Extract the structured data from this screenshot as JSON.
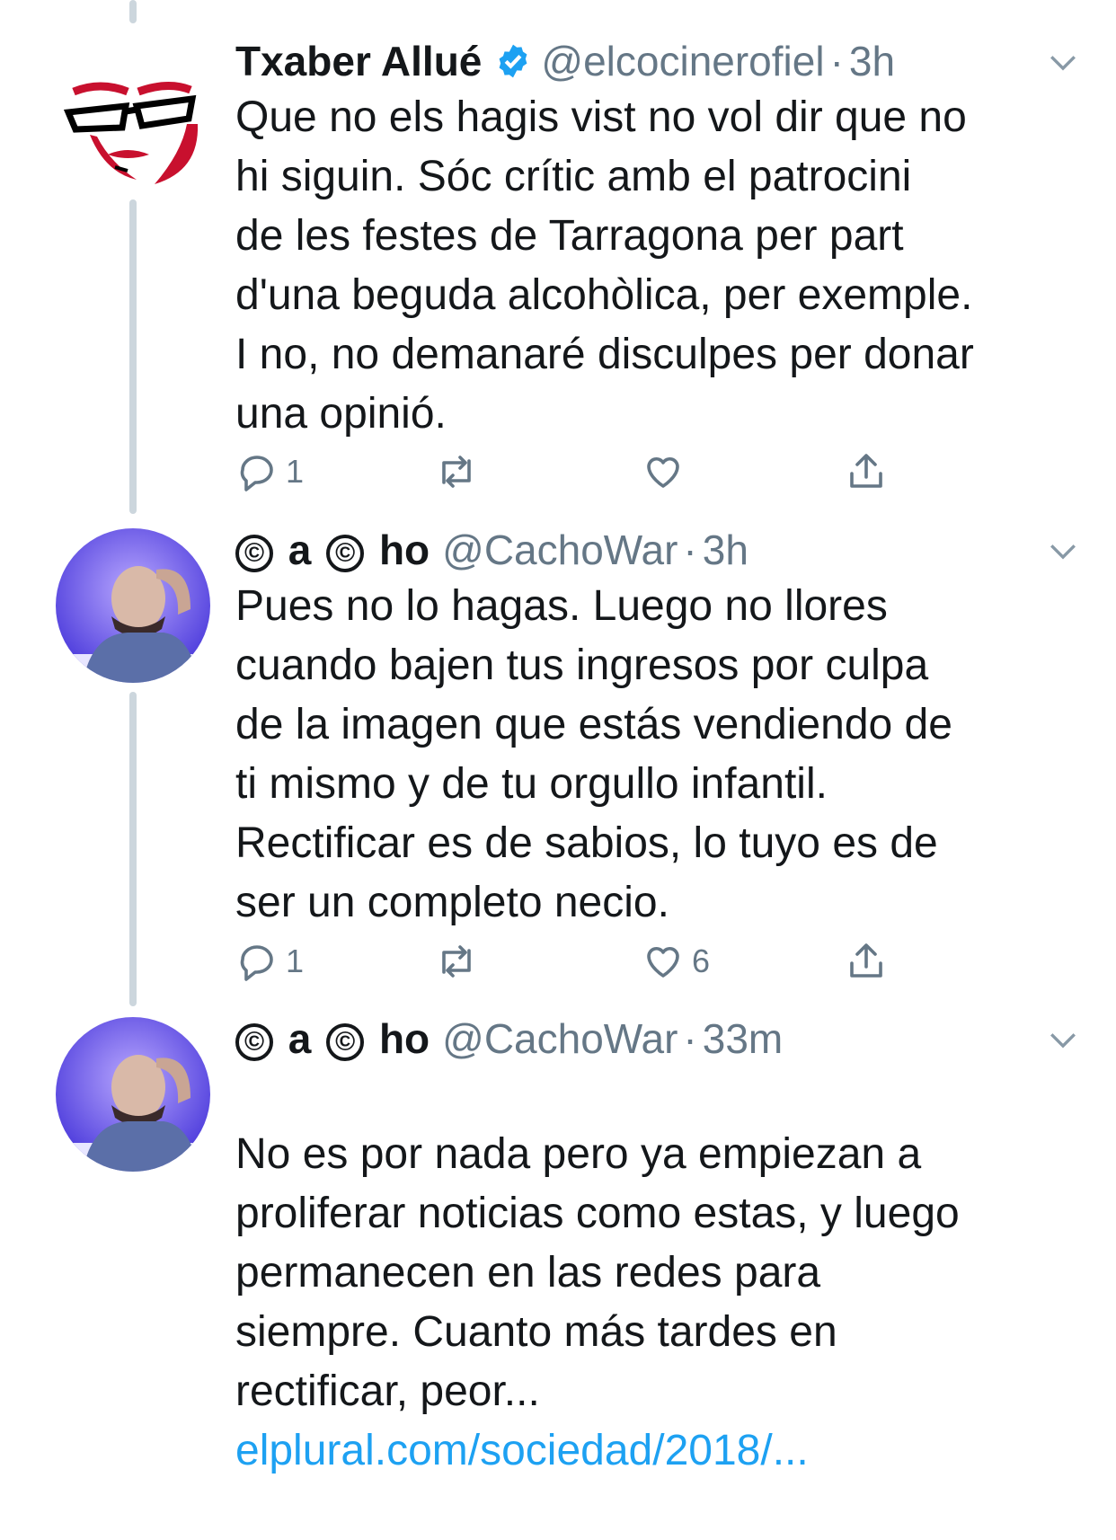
{
  "tweets": [
    {
      "name": "Txaber Allué",
      "handle": "@elcocinerofiel",
      "separator": "·",
      "time": "3h",
      "verified": true,
      "avatar": "cartoon-face-glasses-avatar",
      "text": "Que no els hagis vist no vol dir que no\nhi siguin. Sóc crític amb el patrocini\nde les festes de Tarragona per part\nd'una beguda alcohòlica, per exemple.\nI no, no demanaré disculpes per donar\nuna opinió.",
      "replies": "1",
      "retweets": "",
      "likes": ""
    },
    {
      "name_parts": [
        "©",
        "a",
        "©",
        "ho"
      ],
      "handle": "@CachoWar",
      "separator": "·",
      "time": "3h",
      "verified": false,
      "avatar": "bald-man-photo-avatar",
      "text": "Pues no lo hagas. Luego no llores\ncuando bajen tus ingresos por culpa\nde la imagen que estás vendiendo de\nti mismo y de tu orgullo infantil.\nRectificar es de sabios, lo tuyo es de\nser un completo necio.",
      "replies": "1",
      "retweets": "",
      "likes": "6"
    },
    {
      "name_parts": [
        "©",
        "a",
        "©",
        "ho"
      ],
      "handle": "@CachoWar",
      "separator": "·",
      "time": "33m",
      "verified": false,
      "avatar": "bald-man-photo-avatar",
      "text": "No es por nada pero ya empiezan a\nproliferar noticias como estas, y luego\npermanecen en las redes para\nsiempre. Cuanto más tardes en\nrectificar, peor...",
      "link": "elplural.com/sociedad/2018/..."
    }
  ],
  "icons": [
    "reply-icon",
    "retweet-icon",
    "like-icon",
    "share-icon",
    "chevron-down-icon",
    "verified-badge-icon"
  ],
  "colors": {
    "link": "#1da1f2",
    "muted": "#657786",
    "verified": "#1da1f2",
    "thread_line": "#ccd6dd"
  }
}
